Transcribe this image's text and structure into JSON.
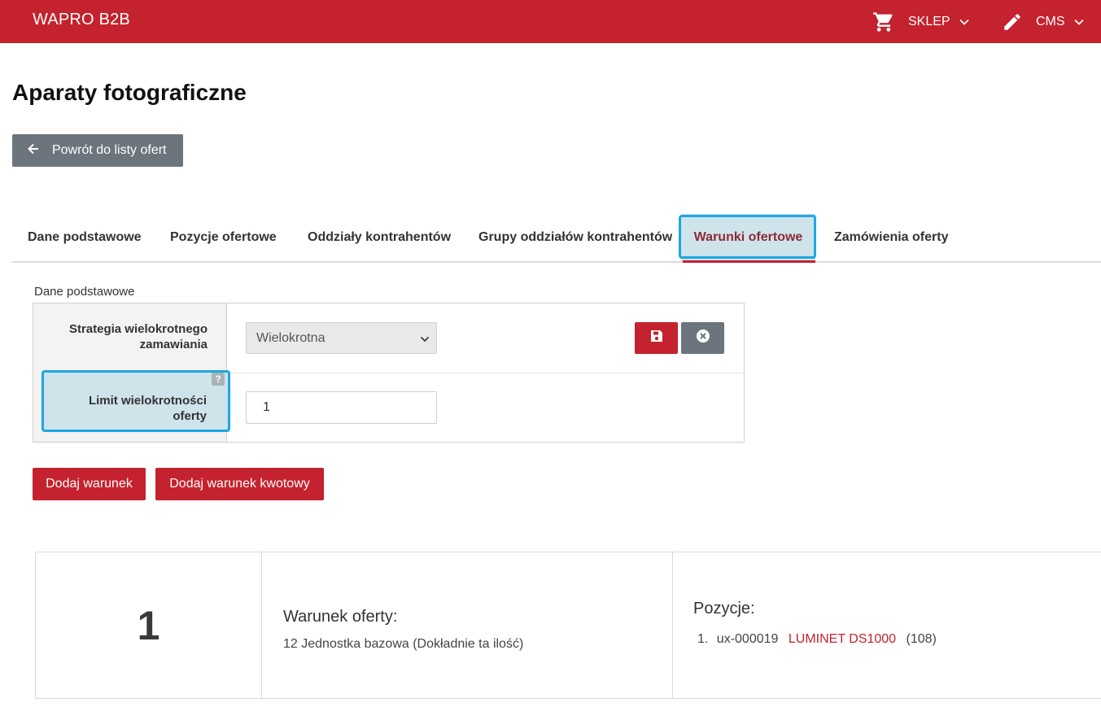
{
  "header": {
    "brand": "WAPRO B2B",
    "shop_label": "SKLEP",
    "cms_label": "CMS",
    "accent_color": "#c4222e"
  },
  "page": {
    "title": "Aparaty fotograficzne",
    "back_label": "Powrót do listy ofert"
  },
  "tabs": [
    {
      "label": "Dane podstawowe",
      "active": false
    },
    {
      "label": "Pozycje ofertowe",
      "active": false
    },
    {
      "label": "Oddziały kontrahentów",
      "active": false
    },
    {
      "label": "Grupy oddziałów kontrahentów",
      "active": false
    },
    {
      "label": "Warunki ofertowe",
      "active": true
    },
    {
      "label": "Zamówienia oferty",
      "active": false
    }
  ],
  "form": {
    "section_label": "Dane podstawowe",
    "strategy_label": "Strategia wielokrotnego zamawiania",
    "strategy_value": "Wielokrotna",
    "limit_label": "Limit wielokrotności oferty",
    "limit_value": "1",
    "help_glyph": "?"
  },
  "actions": {
    "add_condition": "Dodaj warunek",
    "add_amount_condition": "Dodaj warunek kwotowy"
  },
  "conditions": [
    {
      "number": "1",
      "title": "Warunek oferty:",
      "description": "12 Jednostka bazowa (Dokładnie ta ilość)",
      "positions_title": "Pozycje:",
      "positions": [
        {
          "index": "1.",
          "code": "ux-000019",
          "name": "LUMINET DS1000",
          "qty": "(108)"
        }
      ]
    }
  ]
}
